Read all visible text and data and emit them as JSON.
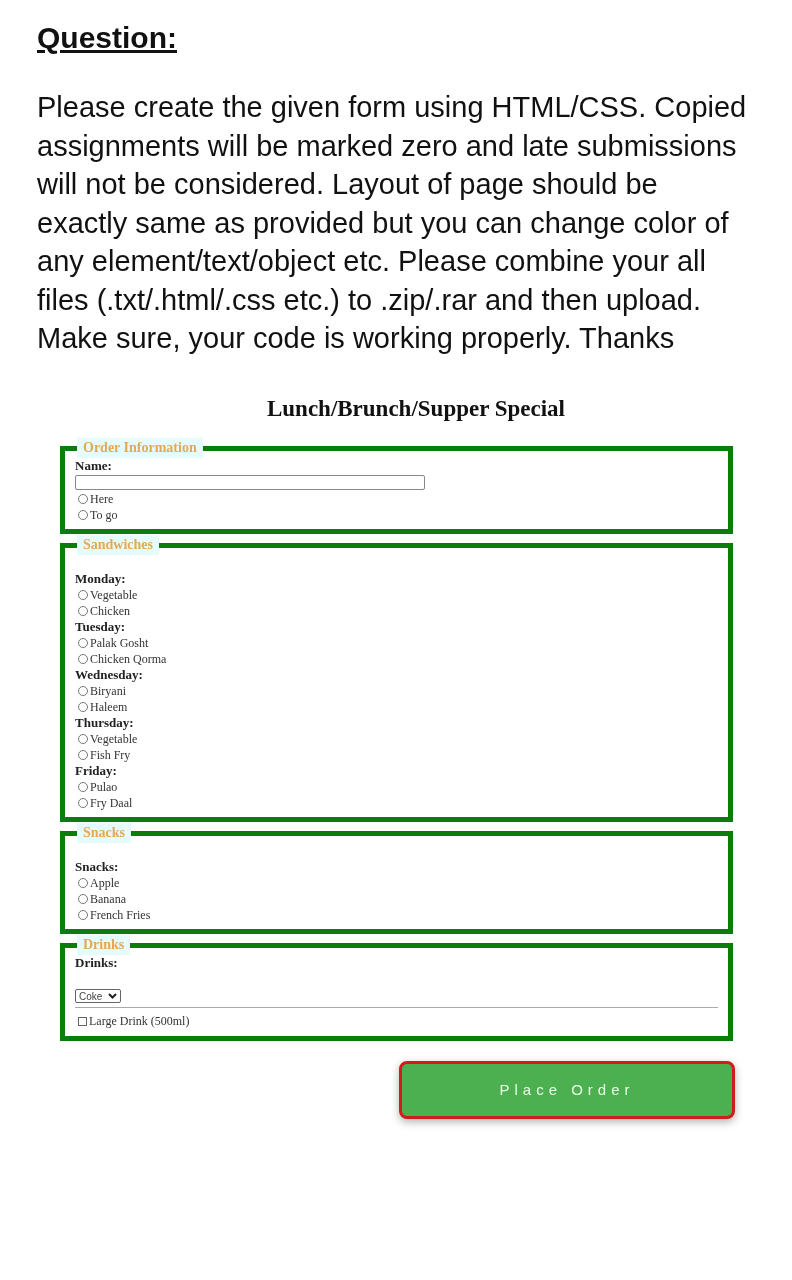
{
  "question": {
    "heading": "Question:",
    "text": "Please create the given form using HTML/CSS. Copied assignments will be marked zero and late submissions will not be considered. Layout of page should be exactly same as provided but you can change color of any element/text/object etc. Please combine your all files (.txt/.html/.css etc.) to .zip/.rar and then upload. Make sure, your code is working properly. Thanks"
  },
  "form": {
    "title": "Lunch/Brunch/Supper Special",
    "sections": [
      {
        "legend": "Order Information",
        "items": [
          {
            "kind": "label",
            "text": "Name:"
          },
          {
            "kind": "text_input",
            "value": ""
          },
          {
            "kind": "radio",
            "text": "Here",
            "selected": false
          },
          {
            "kind": "radio",
            "text": "To go",
            "selected": false
          }
        ]
      },
      {
        "legend": "Sandwiches",
        "items": [
          {
            "kind": "break"
          },
          {
            "kind": "label",
            "text": "Monday:"
          },
          {
            "kind": "radio",
            "text": "Vegetable",
            "selected": false
          },
          {
            "kind": "radio",
            "text": "Chicken",
            "selected": false
          },
          {
            "kind": "label",
            "text": "Tuesday:"
          },
          {
            "kind": "radio",
            "text": "Palak Gosht",
            "selected": false
          },
          {
            "kind": "radio",
            "text": "Chicken Qorma",
            "selected": false
          },
          {
            "kind": "label",
            "text": "Wednesday:"
          },
          {
            "kind": "radio",
            "text": "Biryani",
            "selected": false
          },
          {
            "kind": "radio",
            "text": "Haleem",
            "selected": false
          },
          {
            "kind": "label",
            "text": "Thursday:"
          },
          {
            "kind": "radio",
            "text": "Vegetable",
            "selected": false
          },
          {
            "kind": "radio",
            "text": "Fish Fry",
            "selected": false
          },
          {
            "kind": "label",
            "text": "Friday:"
          },
          {
            "kind": "radio",
            "text": "Pulao",
            "selected": false
          },
          {
            "kind": "radio",
            "text": "Fry Daal",
            "selected": false
          }
        ]
      },
      {
        "legend": "Snacks",
        "items": [
          {
            "kind": "break"
          },
          {
            "kind": "label",
            "text": "Snacks:"
          },
          {
            "kind": "radio",
            "text": "Apple",
            "selected": false
          },
          {
            "kind": "radio",
            "text": "Banana",
            "selected": false
          },
          {
            "kind": "radio",
            "text": "French Fries",
            "selected": false
          }
        ]
      },
      {
        "legend": "Drinks",
        "items": [
          {
            "kind": "label",
            "text": "Drinks:"
          },
          {
            "kind": "break"
          },
          {
            "kind": "select",
            "value": "Coke"
          },
          {
            "kind": "rule"
          },
          {
            "kind": "checkbox",
            "text": "Large Drink (500ml)",
            "checked": false
          }
        ]
      }
    ],
    "button": "Place Order"
  }
}
